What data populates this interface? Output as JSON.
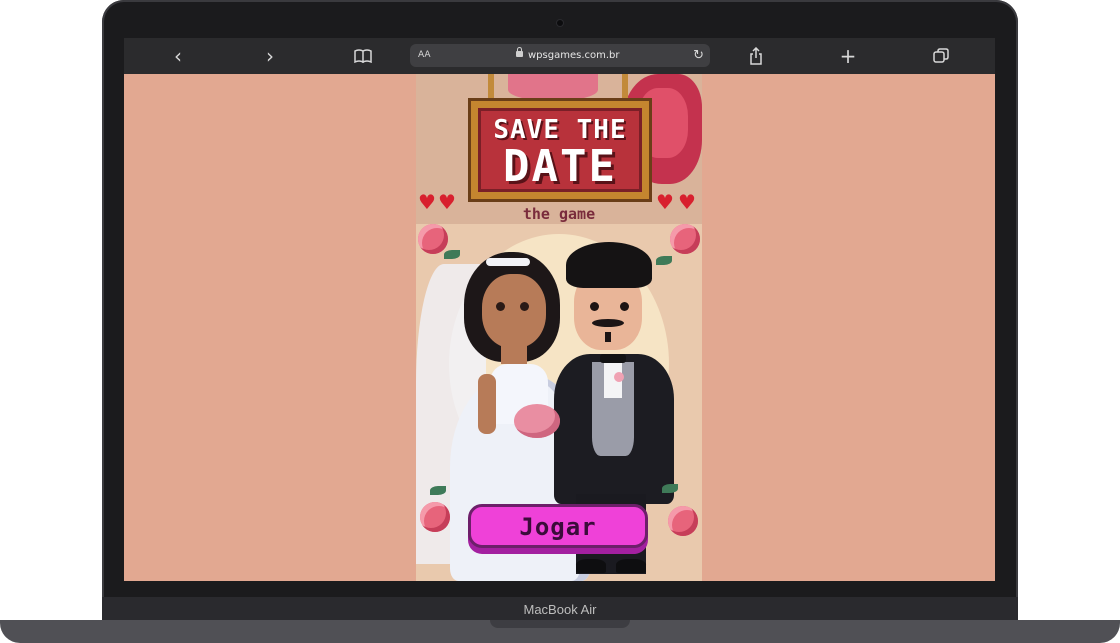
{
  "browser": {
    "back_icon": "‹",
    "forward_icon": "›",
    "bookmarks_icon": "book-icon",
    "text_size": "AA",
    "url": "wpsgames.com.br",
    "reload_icon": "↻",
    "share_icon": "share-icon",
    "new_tab_icon": "+",
    "tabs_icon": "tabs-icon"
  },
  "game": {
    "sign_line1": "SAVE THE",
    "sign_line2": "DATE",
    "subtitle": "the game",
    "play_label": "Jogar"
  },
  "device": {
    "model": "MacBook Air"
  },
  "colors": {
    "page_background": "#e2a891",
    "play_button": "#ef41d8",
    "sign_red": "#b8323b"
  }
}
